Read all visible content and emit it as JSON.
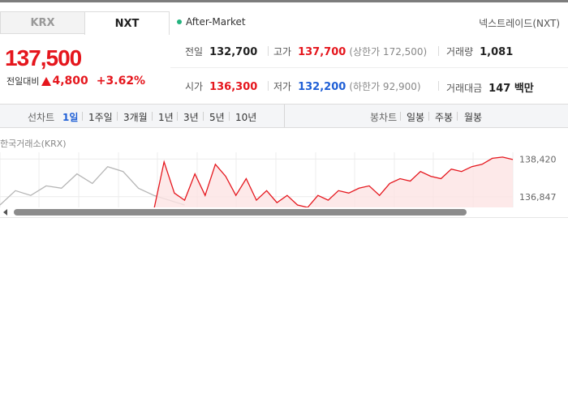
{
  "tabs": [
    {
      "label": "KRX",
      "active": false
    },
    {
      "label": "NXT",
      "active": true
    }
  ],
  "session_label": "After-Market",
  "exchange_label": "넥스트레이드(NXT)",
  "quote": {
    "price": "137,500",
    "change_label": "전일대비",
    "change_amount": "4,800",
    "change_percent": "+3.62%",
    "direction": "up"
  },
  "stats": {
    "prev_close": {
      "label": "전일",
      "value": "132,700"
    },
    "high": {
      "label": "고가",
      "value": "137,700",
      "sub": "(상한가 172,500)"
    },
    "volume": {
      "label": "거래량",
      "value": "1,081"
    },
    "open": {
      "label": "시가",
      "value": "136,300"
    },
    "low": {
      "label": "저가",
      "value": "132,200",
      "sub": "(하한가 92,900)"
    },
    "amount": {
      "label": "거래대금",
      "value": "147 백만"
    }
  },
  "period_bar": {
    "line_label": "선차트",
    "line_periods": [
      "1일",
      "1주일",
      "3개월",
      "1년",
      "3년",
      "5년",
      "10년"
    ],
    "active_period": "1일",
    "candle_label": "봉차트",
    "candle_periods": [
      "일봉",
      "주봉",
      "월봉"
    ]
  },
  "chart_caption": "한국거래소(KRX)",
  "chart_data": {
    "type": "line",
    "y_ticks": [
      138420,
      136847
    ],
    "y_tick_labels": [
      "138,420",
      "136,847"
    ],
    "visible_ylim": [
      136400,
      138700
    ],
    "series": [
      {
        "color": "#b5b5b5",
        "x": [
          0.0,
          0.03,
          0.06,
          0.09,
          0.12,
          0.15,
          0.18,
          0.21,
          0.24,
          0.27,
          0.3,
          0.33,
          0.36
        ],
        "y": [
          136500,
          137100,
          136900,
          137300,
          137200,
          137800,
          137400,
          138100,
          137900,
          137200,
          136900,
          136700,
          136500
        ]
      },
      {
        "color": "#e5161d",
        "x": [
          0.3,
          0.32,
          0.34,
          0.36,
          0.38,
          0.4,
          0.42,
          0.44,
          0.46,
          0.48,
          0.5,
          0.52,
          0.54,
          0.56,
          0.58,
          0.6,
          0.62,
          0.64,
          0.66,
          0.68,
          0.7,
          0.72,
          0.74,
          0.76,
          0.78,
          0.8,
          0.82,
          0.84,
          0.86,
          0.88,
          0.9,
          0.92,
          0.94,
          0.96,
          0.98,
          1.0
        ],
        "y": [
          136300,
          138300,
          137000,
          136700,
          137800,
          136900,
          138200,
          137700,
          136900,
          137600,
          136700,
          137100,
          136600,
          136900,
          136500,
          136400,
          136900,
          136700,
          137100,
          137000,
          137200,
          137300,
          136900,
          137400,
          137600,
          137500,
          137900,
          137700,
          137600,
          138000,
          137900,
          138100,
          138200,
          138450,
          138500,
          138400
        ]
      }
    ]
  }
}
